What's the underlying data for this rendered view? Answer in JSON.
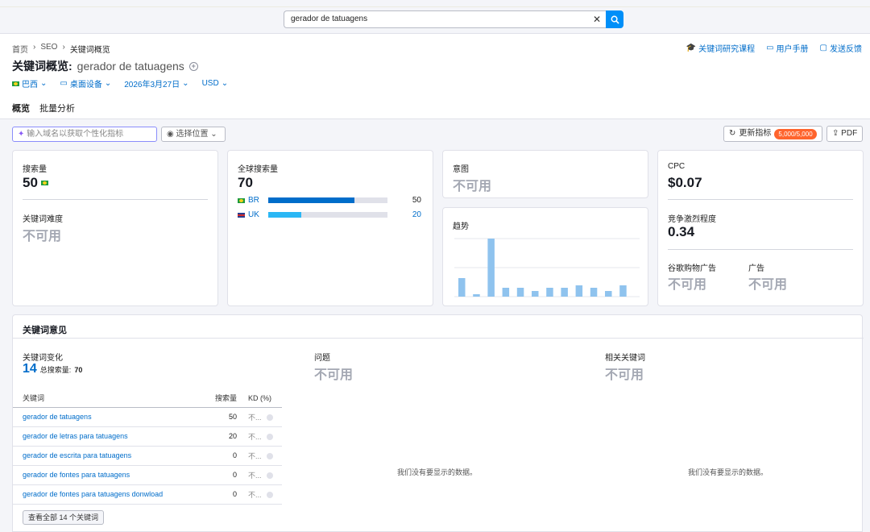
{
  "search": {
    "value": "gerador de tatuagens"
  },
  "breadcrumb": [
    "首页",
    "SEO",
    "关键词概览"
  ],
  "header_links": [
    "关键词研究课程",
    "用户手册",
    "发送反馈"
  ],
  "title": {
    "label": "关键词概览:",
    "keyword": "gerador de tatuagens"
  },
  "filters": {
    "country": "巴西",
    "device": "桌面设备",
    "date": "2026年3月27日",
    "currency": "USD"
  },
  "tabs": [
    "概览",
    "批量分析"
  ],
  "toolbar": {
    "domain_placeholder": "输入域名以获取个性化指标",
    "location": "选择位置",
    "update": "更新指标",
    "update_badge": "5,000/5,000",
    "pdf": "PDF"
  },
  "volume": {
    "label": "搜索量",
    "value": "50"
  },
  "kd": {
    "label": "关键词难度",
    "value": "不可用"
  },
  "global": {
    "label": "全球搜索量",
    "value": "70",
    "countries": [
      {
        "code": "BR",
        "value": "50",
        "share": 0.72,
        "color": "#006dca"
      },
      {
        "code": "UK",
        "value": "20",
        "share": 0.28,
        "color": "#2bb7f5"
      }
    ]
  },
  "intent": {
    "label": "意图",
    "value": "不可用"
  },
  "trend": {
    "label": "趋势"
  },
  "chart_data": {
    "type": "bar",
    "title": "趋势",
    "values": [
      23,
      3,
      72,
      11,
      11,
      7,
      11,
      11,
      14,
      11,
      7,
      14
    ]
  },
  "cpc": {
    "label": "CPC",
    "value": "$0.07"
  },
  "competition": {
    "label": "竞争激烈程度",
    "value": "0.34"
  },
  "shopping": {
    "label": "谷歌购物广告",
    "value": "不可用"
  },
  "ads": {
    "label": "广告",
    "value": "不可用"
  },
  "ideas": {
    "title": "关键词意见",
    "variations": {
      "label": "关键词变化",
      "count": "14",
      "total_label": "总搜索量:",
      "total": "70"
    },
    "table": {
      "headers": [
        "关键词",
        "搜索量",
        "KD (%)"
      ],
      "rows": [
        {
          "keyword": "gerador de tatuagens",
          "volume": "50",
          "kd": "不..."
        },
        {
          "keyword": "gerador de letras para tatuagens",
          "volume": "20",
          "kd": "不..."
        },
        {
          "keyword": "gerador de escrita para tatuagens",
          "volume": "0",
          "kd": "不..."
        },
        {
          "keyword": "gerador de fontes para tatuagens",
          "volume": "0",
          "kd": "不..."
        },
        {
          "keyword": "gerador de fontes para tatuagens donwload",
          "volume": "0",
          "kd": "不..."
        }
      ]
    },
    "view_all": "查看全部 14 个关键词",
    "questions": {
      "label": "问题",
      "value": "不可用",
      "empty": "我们没有要显示的数据。"
    },
    "related": {
      "label": "相关关键词",
      "value": "不可用",
      "empty": "我们没有要显示的数据。"
    }
  }
}
